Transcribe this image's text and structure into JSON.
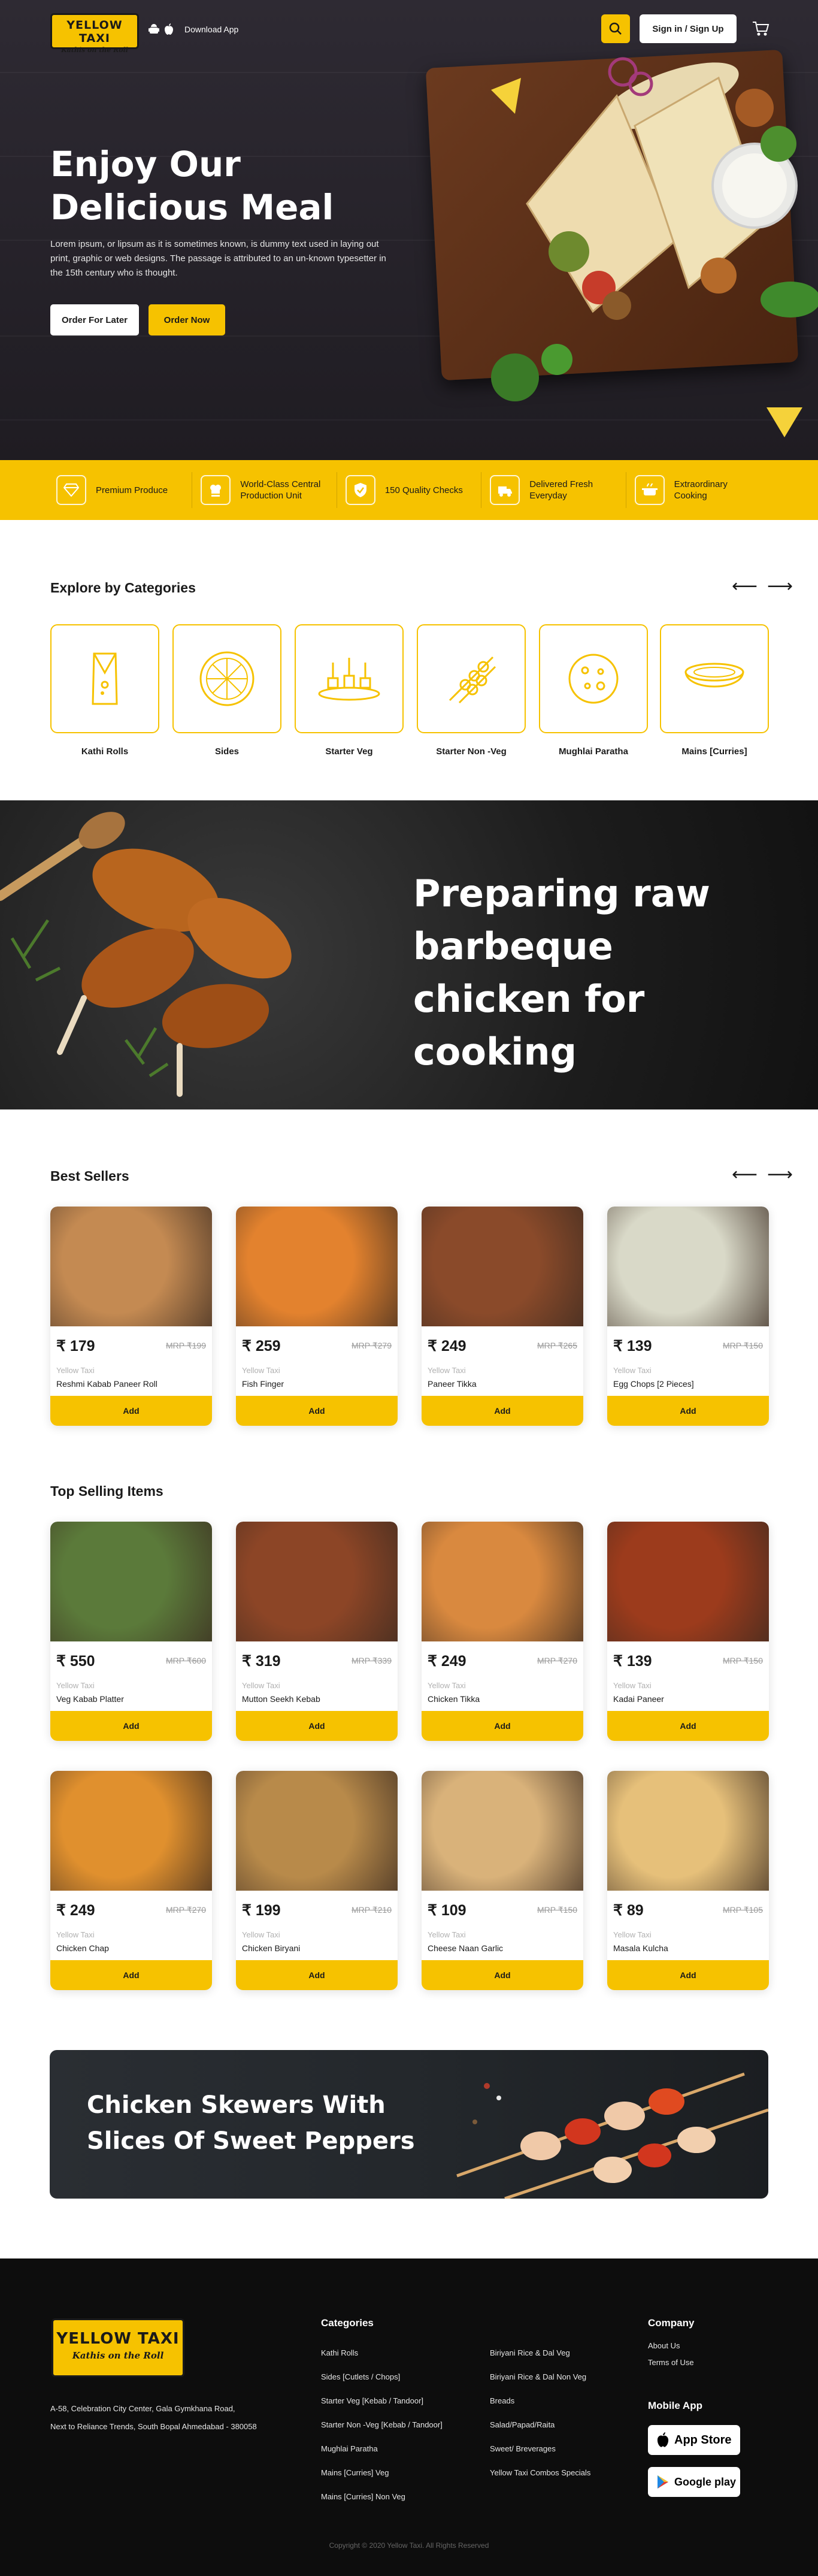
{
  "header": {
    "logo_title": "YELLOW TAXI",
    "logo_subtitle": "Kathis on the Roll",
    "download_app": "Download App",
    "signin": "Sign in / Sign Up"
  },
  "hero": {
    "title": "Enjoy Our Delicious Meal",
    "description": "Lorem ipsum, or lipsum as it is sometimes known, is dummy text used in laying out print, graphic or web designs. The passage is attributed to an un-known typesetter in the 15th century who is thought.",
    "btn_later": "Order For Later",
    "btn_now": "Order Now"
  },
  "features": [
    {
      "label": "Premium Produce",
      "icon": "diamond-icon"
    },
    {
      "label": "World-Class Central Production Unit",
      "icon": "chef-hat-icon"
    },
    {
      "label": "150 Quality Checks",
      "icon": "shield-check-icon"
    },
    {
      "label": "Delivered Fresh Everyday",
      "icon": "delivery-icon"
    },
    {
      "label": "Extraordinary Cooking",
      "icon": "cooking-pot-icon"
    }
  ],
  "categories": {
    "title": "Explore by Categories",
    "items": [
      {
        "label": "Kathi Rolls",
        "icon": "roll-icon"
      },
      {
        "label": "Sides",
        "icon": "pizza-icon"
      },
      {
        "label": "Starter Veg",
        "icon": "canape-icon"
      },
      {
        "label": "Starter Non -Veg",
        "icon": "skewer-icon"
      },
      {
        "label": "Mughlai Paratha",
        "icon": "paratha-icon"
      },
      {
        "label": "Mains [Curries]",
        "icon": "curry-bowl-icon"
      }
    ]
  },
  "banner": {
    "title": "Preparing raw barbeque chicken for cooking"
  },
  "best_sellers": {
    "title": "Best Sellers",
    "items": [
      {
        "price": "179",
        "mrp": "MRP ₹199",
        "brand": "Yellow Taxi",
        "name": "Reshmi Kabab Paneer Roll",
        "add": "Add",
        "color": "#c48a52"
      },
      {
        "price": "259",
        "mrp": "MRP ₹279",
        "brand": "Yellow Taxi",
        "name": "Fish Finger",
        "add": "Add",
        "color": "#e3822e"
      },
      {
        "price": "249",
        "mrp": "MRP ₹265",
        "brand": "Yellow Taxi",
        "name": "Paneer Tikka",
        "add": "Add",
        "color": "#8a4a2a"
      },
      {
        "price": "139",
        "mrp": "MRP ₹150",
        "brand": "Yellow Taxi",
        "name": "Egg Chops [2 Pieces]",
        "add": "Add",
        "color": "#d9d9c8"
      }
    ]
  },
  "top_selling": {
    "title": "Top Selling Items",
    "items": [
      {
        "price": "550",
        "mrp": "MRP ₹600",
        "brand": "Yellow Taxi",
        "name": "Veg Kabab Platter",
        "add": "Add",
        "color": "#5b7a3a"
      },
      {
        "price": "319",
        "mrp": "MRP ₹339",
        "brand": "Yellow Taxi",
        "name": "Mutton Seekh Kebab",
        "add": "Add",
        "color": "#8c4526"
      },
      {
        "price": "249",
        "mrp": "MRP ₹270",
        "brand": "Yellow Taxi",
        "name": "Chicken Tikka",
        "add": "Add",
        "color": "#d9893f"
      },
      {
        "price": "139",
        "mrp": "MRP ₹150",
        "brand": "Yellow Taxi",
        "name": "Kadai Paneer",
        "add": "Add",
        "color": "#9c3b1c"
      },
      {
        "price": "249",
        "mrp": "MRP ₹270",
        "brand": "Yellow Taxi",
        "name": "Chicken Chap",
        "add": "Add",
        "color": "#e0902e"
      },
      {
        "price": "199",
        "mrp": "MRP ₹210",
        "brand": "Yellow Taxi",
        "name": "Chicken Biryani",
        "add": "Add",
        "color": "#b88a4a"
      },
      {
        "price": "109",
        "mrp": "MRP ₹150",
        "brand": "Yellow Taxi",
        "name": "Cheese Naan Garlic",
        "add": "Add",
        "color": "#d9b27a"
      },
      {
        "price": "89",
        "mrp": "MRP ₹105",
        "brand": "Yellow Taxi",
        "name": "Masala Kulcha",
        "add": "Add",
        "color": "#e6c07a"
      }
    ]
  },
  "skewer_banner": {
    "title": "Chicken Skewers With Slices Of Sweet Peppers"
  },
  "footer": {
    "logo_title": "YELLOW TAXI",
    "logo_subtitle": "Kathis on the Roll",
    "address_line1": "A-58, Celebration City Center, Gala Gymkhana Road,",
    "address_line2": "Next to Reliance Trends, South Bopal Ahmedabad - 380058",
    "categories_title": "Categories",
    "categories_col1": [
      "Kathi Rolls",
      "Sides [Cutlets / Chops]",
      "Starter Veg [Kebab / Tandoor]",
      "Starter Non -Veg [Kebab / Tandoor]",
      "Mughlai Paratha",
      "Mains [Curries] Veg",
      "Mains [Curries] Non Veg"
    ],
    "categories_col2": [
      "Biriyani Rice & Dal Veg",
      "Biriyani Rice & Dal Non Veg",
      "Breads",
      "Salad/Papad/Raita",
      "Sweet/ Breverages",
      "Yellow Taxi Combos Specials"
    ],
    "company_title": "Company",
    "company_links": [
      "About Us",
      "Terms of Use"
    ],
    "mobile_title": "Mobile App",
    "app_store": "App Store",
    "google_play": "Google play",
    "copyright": "Copyright © 2020 Yellow Taxi. All Rights Reserved"
  },
  "colors": {
    "accent": "#f6c200",
    "dark": "#1a1a1a",
    "footer": "#0d0d0d"
  }
}
